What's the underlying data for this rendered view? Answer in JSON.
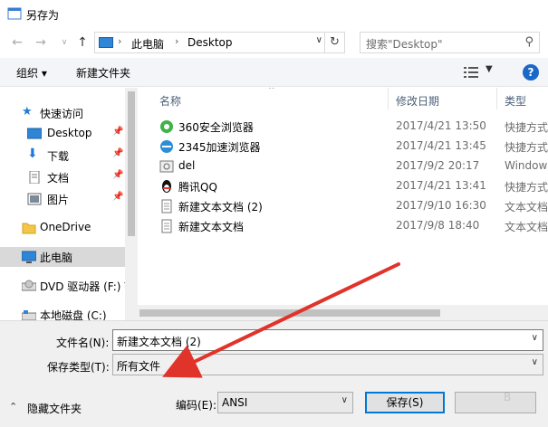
{
  "window": {
    "title": "另存为"
  },
  "address": {
    "crumbs": [
      "此电脑",
      "Desktop"
    ],
    "search_placeholder": "搜索\"Desktop\""
  },
  "toolbar": {
    "organize": "组织 ▾",
    "new_folder": "新建文件夹",
    "help": "?"
  },
  "nav": {
    "quick_access": "快速访问",
    "desktop": "Desktop",
    "downloads": "下载",
    "documents": "文档",
    "pictures": "图片",
    "onedrive": "OneDrive",
    "this_pc": "此电脑",
    "dvd": "DVD 驱动器 (F:) V",
    "local_disk": "本地磁盘 (C:)"
  },
  "columns": {
    "name": "名称",
    "modified": "修改日期",
    "type": "类型"
  },
  "files": [
    {
      "name": "360安全浏览器",
      "date": "2017/4/21 13:50",
      "type": "快捷方式",
      "icon": "360-browser-icon"
    },
    {
      "name": "2345加速浏览器",
      "date": "2017/4/21 13:45",
      "type": "快捷方式",
      "icon": "2345-browser-icon"
    },
    {
      "name": "del",
      "date": "2017/9/2 20:17",
      "type": "Window",
      "icon": "script-file-icon"
    },
    {
      "name": "腾讯QQ",
      "date": "2017/4/21 13:41",
      "type": "快捷方式",
      "icon": "qq-penguin-icon"
    },
    {
      "name": "新建文本文档 (2)",
      "date": "2017/9/10 16:30",
      "type": "文本文档",
      "icon": "text-document-icon"
    },
    {
      "name": "新建文本文档",
      "date": "2017/9/8 18:40",
      "type": "文本文档",
      "icon": "text-document-icon"
    }
  ],
  "form": {
    "filename_label": "文件名(N):",
    "filename_value": "新建文本文档 (2)",
    "filetype_label": "保存类型(T):",
    "filetype_value": "所有文件",
    "hide_folders": "隐藏文件夹",
    "encoding_label": "编码(E):",
    "encoding_value": "ANSI",
    "save": "保存(S)",
    "cancel": ""
  },
  "colors": {
    "accent": "#0078d7",
    "annotation_arrow": "#e0332a",
    "selection": "#d9d9d9"
  }
}
